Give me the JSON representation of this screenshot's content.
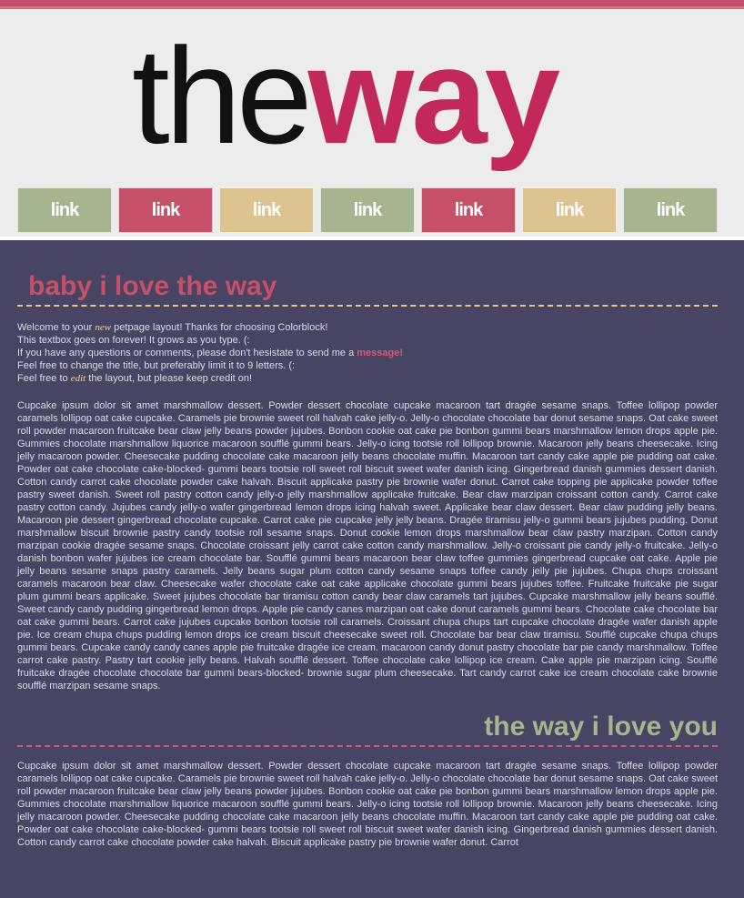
{
  "header": {
    "logo_part1": "the",
    "logo_part2": "way",
    "nav": [
      {
        "label": "link",
        "color": "#a6b58f"
      },
      {
        "label": "link",
        "color": "#c55068"
      },
      {
        "label": "link",
        "color": "#dcc38f"
      },
      {
        "label": "link",
        "color": "#a6b58f"
      },
      {
        "label": "link",
        "color": "#c55068"
      },
      {
        "label": "link",
        "color": "#dcc38f"
      },
      {
        "label": "link",
        "color": "#a6b58f"
      }
    ]
  },
  "section1": {
    "title": "baby i love the way",
    "intro": {
      "l1a": "Welcome to your ",
      "l1b": "new",
      "l1c": " petpage layout! Thanks for choosing Colorblock!",
      "l2": "This textbox goes on forever! It grows as you type. (:",
      "l3a": "If you have any questions or comments, please don't hesistate to send me a ",
      "l3b": "message!",
      "l4": "Feel free to change the title, but preferably limit it to 9 letters. (:",
      "l5a": "Feel free to ",
      "l5b": "edit",
      "l5c": " the layout, but please keep credit on!"
    },
    "body": "Cupcake ipsum dolor sit amet marshmallow dessert. Powder dessert chocolate cupcake macaroon tart dragée sesame snaps. Toffee lollipop powder caramels lollipop oat cake cupcake. Caramels pie brownie sweet roll halvah cake jelly-o. Jelly-o chocolate chocolate bar donut sesame snaps. Oat cake sweet roll powder macaroon fruitcake bear claw jelly beans powder jujubes. Bonbon cookie oat cake pie bonbon gummi bears marshmallow lemon drops apple pie. Gummies chocolate marshmallow liquorice macaroon soufflé gummi bears. Jelly-o icing tootsie roll lollipop brownie. Macaroon jelly beans cheesecake. Icing jelly macaroon powder. Cheesecake pudding chocolate cake macaroon jelly beans chocolate muffin. Macaroon tart candy cake apple pie pudding oat cake. Powder oat cake chocolate cake-blocked- gummi bears tootsie roll sweet roll biscuit sweet wafer danish icing. Gingerbread danish gummies dessert danish. Cotton candy carrot cake chocolate powder cake halvah. Biscuit applicake pastry pie brownie wafer donut. Carrot cake topping pie applicake powder toffee pastry sweet danish. Sweet roll pastry cotton candy jelly-o jelly marshmallow applicake fruitcake. Bear claw marzipan croissant cotton candy. Carrot cake pastry cotton candy. Jujubes candy jelly-o wafer gingerbread lemon drops icing halvah sweet. Applicake bear claw dessert. Bear claw pudding jelly beans. Macaroon pie dessert gingerbread chocolate cupcake. Carrot cake pie cupcake jelly jelly beans. Dragée tiramisu jelly-o gummi bears jujubes pudding. Donut marshmallow biscuit brownie pastry candy tootsie roll sesame snaps. Donut cookie lemon drops marshmallow bear claw pastry marzipan. Cotton candy marzipan cookie dragée sesame snaps. Chocolate croissant jelly carrot cake cotton candy marshmallow. Jelly-o croissant pie candy jelly-o fruitcake. Jelly-o danish bonbon wafer jujubes ice cream chocolate bar. Soufflé gummi bears macaroon bear claw toffee gummies gingerbread cupcake oat cake. Apple pie jelly beans sesame snaps pastry caramels. Jelly beans sugar plum cotton candy sesame snaps toffee candy jelly pie jujubes. Chupa chups croissant caramels macaroon bear claw. Cheesecake wafer chocolate cake oat cake applicake chocolate gummi bears jujubes toffee. Fruitcake fruitcake pie sugar plum gummi bears applicake. Sweet jujubes chocolate bar tiramisu cotton candy bear claw caramels tart jujubes. Cupcake marshmallow jelly beans soufflé. Sweet candy candy pudding gingerbread lemon drops. Apple pie candy canes marzipan oat cake donut caramels gummi bears. Chocolate cake chocolate bar oat cake gummi bears. Carrot cake jujubes cupcake bonbon tootsie roll caramels. Croissant chupa chups tart cupcake chocolate dragée wafer danish apple pie. Ice cream chupa chups pudding lemon drops ice cream biscuit cheesecake sweet roll. Chocolate bar bear claw tiramisu. Soufflé cupcake chupa chups gummi bears. Cupcake candy candy canes apple pie fruitcake dragée ice cream. macaroon candy donut pastry chocolate bar pie candy marshmallow. Toffee carrot cake pastry. Pastry tart cookie jelly beans. Halvah soufflé dessert. Toffee chocolate cake lollipop ice cream. Cake apple pie marzipan icing. Soufflé fruitcake dragée chocolate chocolate bar gummi bears-blocked- brownie sugar plum cheesecake. Tart candy carrot cake ice cream chocolate cake brownie soufflé marzipan sesame snaps."
  },
  "section2": {
    "title": "the way i love you",
    "body": "Cupcake ipsum dolor sit amet marshmallow dessert. Powder dessert chocolate cupcake macaroon tart dragée sesame snaps. Toffee lollipop powder caramels lollipop oat cake cupcake. Caramels pie brownie sweet roll halvah cake jelly-o. Jelly-o chocolate chocolate bar donut sesame snaps. Oat cake sweet roll powder macaroon fruitcake bear claw jelly beans powder jujubes. Bonbon cookie oat cake pie bonbon gummi bears marshmallow lemon drops apple pie. Gummies chocolate marshmallow liquorice macaroon soufflé gummi bears. Jelly-o icing tootsie roll lollipop brownie. Macaroon jelly beans cheesecake. Icing jelly macaroon powder. Cheesecake pudding chocolate cake macaroon jelly beans chocolate muffin. Macaroon tart candy cake apple pie pudding oat cake. Powder oat cake chocolate cake-blocked- gummi bears tootsie roll sweet roll biscuit sweet wafer danish icing. Gingerbread danish gummies dessert danish. Cotton candy carrot cake chocolate powder cake halvah. Biscuit applicake pastry pie brownie wafer donut. Carrot"
  }
}
